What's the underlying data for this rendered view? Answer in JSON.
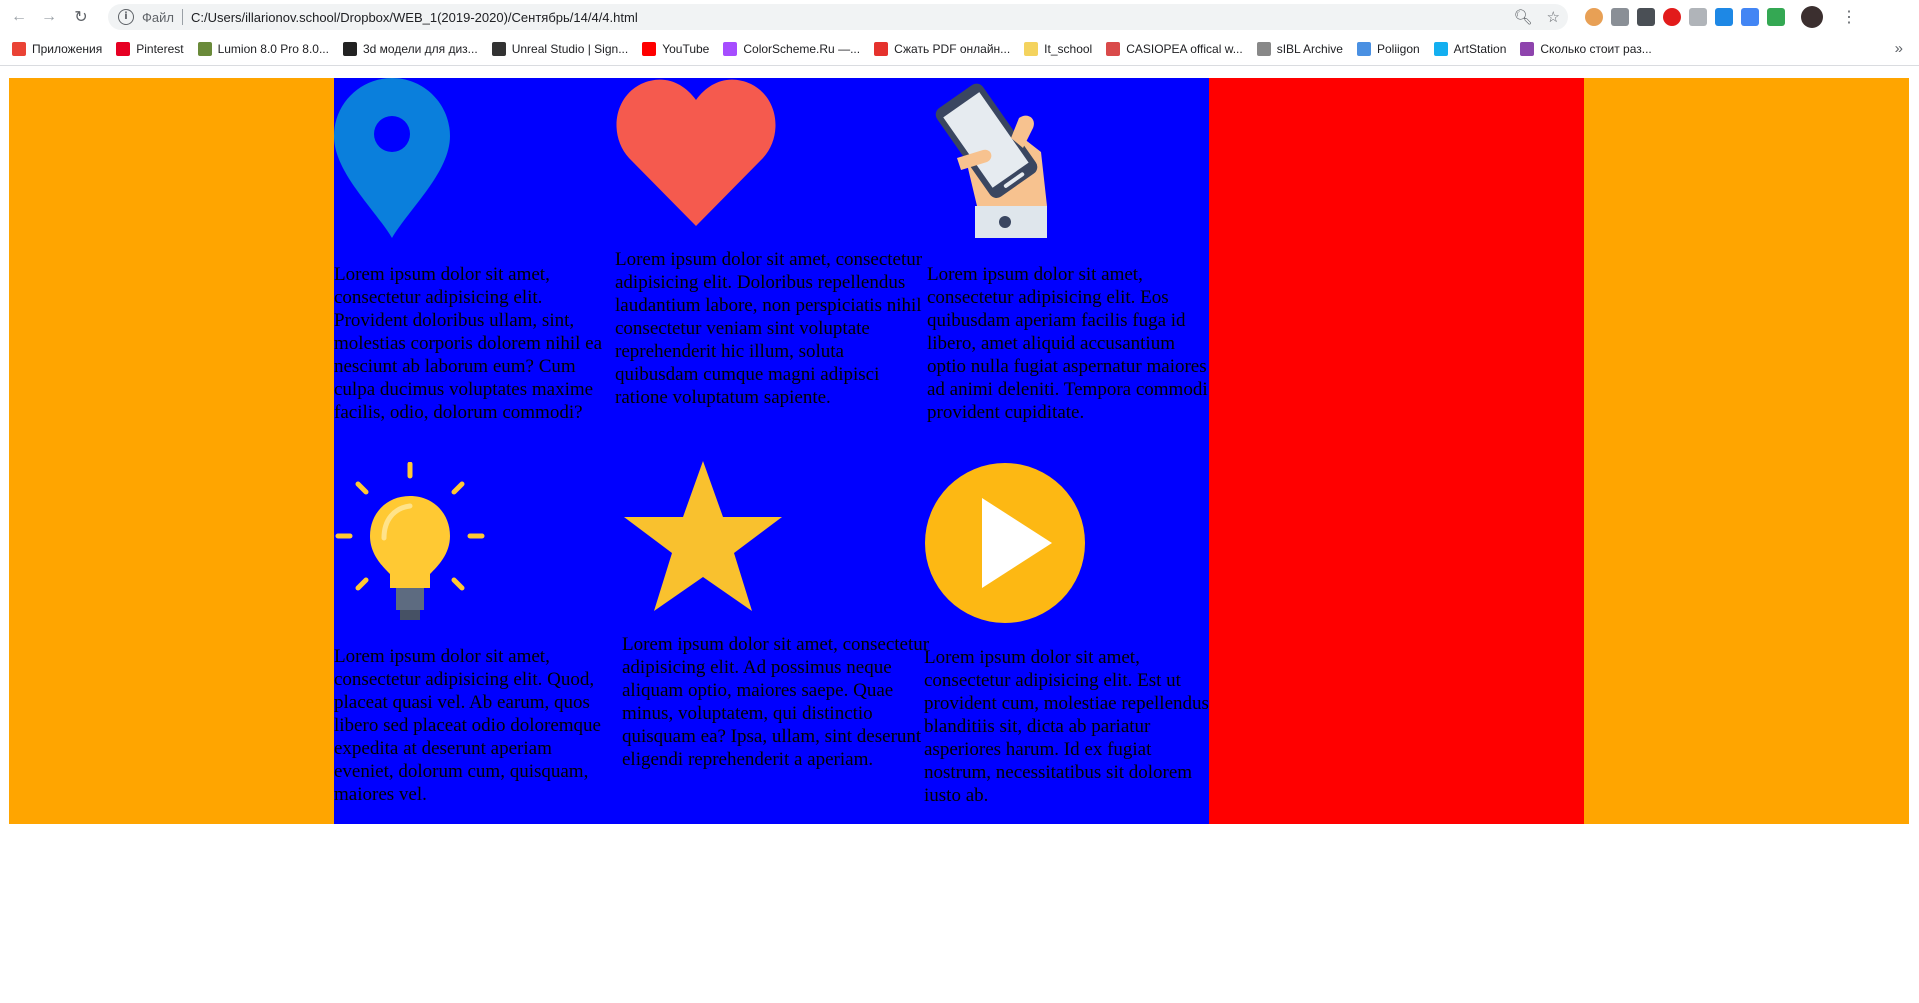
{
  "browser": {
    "url_scheme": "Файл",
    "url": "C:/Users/illarionov.school/Dropbox/WEB_1(2019-2020)/Сентябрь/14/4/4.html"
  },
  "bookmarks": [
    {
      "label": "Приложения",
      "color": "#ea4335"
    },
    {
      "label": "Pinterest",
      "color": "#e60023"
    },
    {
      "label": "Lumion 8.0 Pro 8.0...",
      "color": "#6a8a3a"
    },
    {
      "label": "3d модели для диз...",
      "color": "#222222"
    },
    {
      "label": "Unreal Studio | Sign...",
      "color": "#333333"
    },
    {
      "label": "YouTube",
      "color": "#ff0000"
    },
    {
      "label": "ColorScheme.Ru —...",
      "color": "#a64dff"
    },
    {
      "label": "Сжать PDF онлайн...",
      "color": "#e5322d"
    },
    {
      "label": "It_school",
      "color": "#f4d35e"
    },
    {
      "label": "CASIOPEA offical w...",
      "color": "#d94a4a"
    },
    {
      "label": "sIBL Archive",
      "color": "#888888"
    },
    {
      "label": "Poliigon",
      "color": "#4a90e2"
    },
    {
      "label": "ArtStation",
      "color": "#13aff0"
    },
    {
      "label": "Сколько стоит раз...",
      "color": "#8e44ad"
    }
  ],
  "colors": {
    "outer": "#ffa500",
    "middle": "#0000ff",
    "right_band": "#ff0000"
  },
  "cards": [
    {
      "icon": "map-pin-icon",
      "text": "Lorem ipsum dolor sit amet, consectetur adipisicing elit. Provident doloribus ullam, sint, molestias corporis dolorem nihil ea nesciunt ab laborum eum? Cum culpa ducimus voluptates maxime facilis, odio, dolorum commodi?"
    },
    {
      "icon": "heart-icon",
      "text": "Lorem ipsum dolor sit amet, consectetur adipisicing elit. Doloribus repellendus laudantium labore, non perspiciatis nihil consectetur veniam sint voluptate reprehenderit hic illum, soluta quibusdam cumque magni adipisci ratione voluptatum sapiente."
    },
    {
      "icon": "phone-in-hand-icon",
      "text": "Lorem ipsum dolor sit amet, consectetur adipisicing elit. Eos quibusdam aperiam facilis fuga id libero, amet aliquid accusantium optio nulla fugiat aspernatur maiores ad animi deleniti. Tempora commodi provident cupiditate."
    },
    {
      "icon": "light-bulb-icon",
      "text": "Lorem ipsum dolor sit amet, consectetur adipisicing elit. Quod, placeat quasi vel. Ab earum, quos libero sed placeat odio doloremque expedita at deserunt aperiam eveniet, dolorum cum, quisquam, maiores vel."
    },
    {
      "icon": "star-icon",
      "text": "Lorem ipsum dolor sit amet, consectetur adipisicing elit. Ad possimus neque aliquam optio, maiores saepe. Quae minus, voluptatem, qui distinctio quisquam ea? Ipsa, ullam, sint deserunt eligendi reprehenderit a aperiam."
    },
    {
      "icon": "play-button-icon",
      "text": "Lorem ipsum dolor sit amet, consectetur adipisicing elit. Est ut provident cum, molestiae repellendus blanditiis sit, dicta ab pariatur asperiores harum. Id ex fugiat nostrum, necessitatibus sit dolorem iusto ab."
    }
  ]
}
